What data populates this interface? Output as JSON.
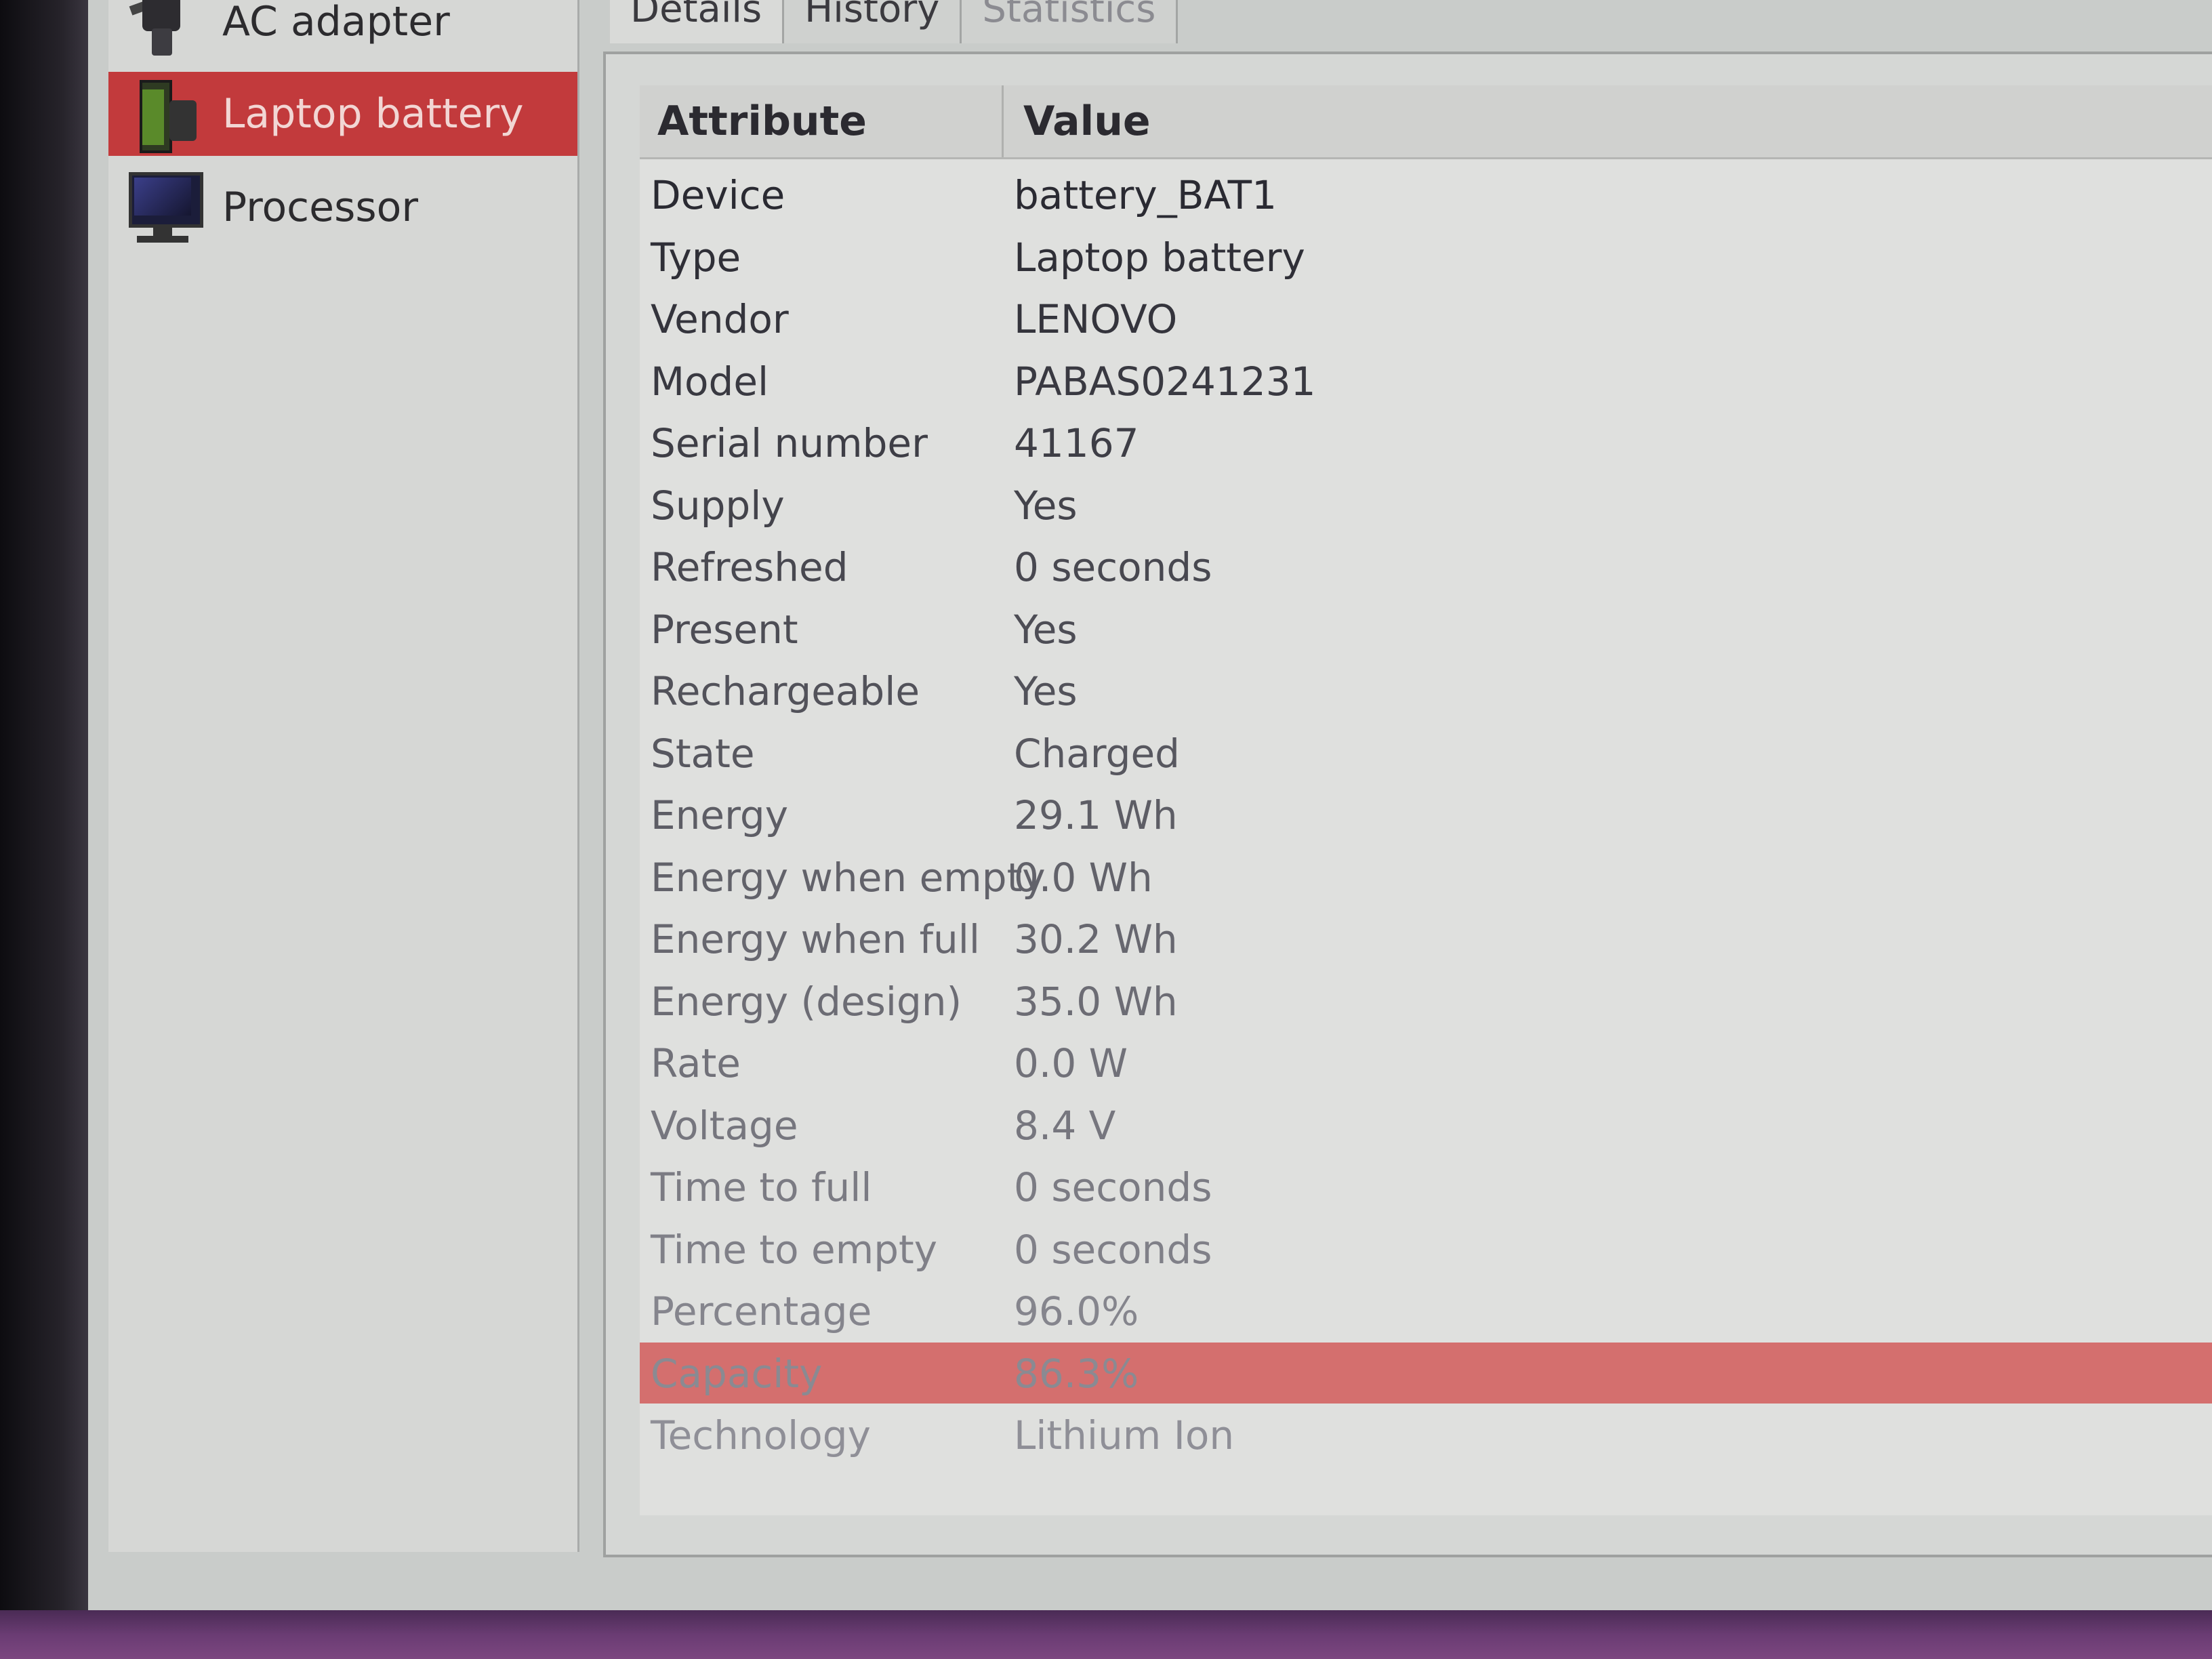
{
  "sidebar": {
    "items": [
      {
        "label": "AC adapter",
        "icon": "ac-adapter-icon"
      },
      {
        "label": "Laptop battery",
        "icon": "battery-icon",
        "selected": true
      },
      {
        "label": "Processor",
        "icon": "processor-icon"
      }
    ]
  },
  "tabs": [
    {
      "label": "Details"
    },
    {
      "label": "History"
    },
    {
      "label": "Statistics"
    }
  ],
  "table": {
    "headers": {
      "attribute": "Attribute",
      "value": "Value"
    },
    "rows": [
      {
        "attribute": "Device",
        "value": "battery_BAT1"
      },
      {
        "attribute": "Type",
        "value": "Laptop battery"
      },
      {
        "attribute": "Vendor",
        "value": "LENOVO"
      },
      {
        "attribute": "Model",
        "value": "PABAS0241231"
      },
      {
        "attribute": "Serial number",
        "value": "41167"
      },
      {
        "attribute": "Supply",
        "value": "Yes"
      },
      {
        "attribute": "Refreshed",
        "value": "0 seconds"
      },
      {
        "attribute": "Present",
        "value": "Yes"
      },
      {
        "attribute": "Rechargeable",
        "value": "Yes"
      },
      {
        "attribute": "State",
        "value": "Charged"
      },
      {
        "attribute": "Energy",
        "value": "29.1 Wh"
      },
      {
        "attribute": "Energy when empty",
        "value": "0.0 Wh"
      },
      {
        "attribute": "Energy when full",
        "value": "30.2 Wh"
      },
      {
        "attribute": "Energy (design)",
        "value": "35.0 Wh"
      },
      {
        "attribute": "Rate",
        "value": "0.0 W"
      },
      {
        "attribute": "Voltage",
        "value": "8.4 V"
      },
      {
        "attribute": "Time to full",
        "value": "0 seconds"
      },
      {
        "attribute": "Time to empty",
        "value": "0 seconds"
      },
      {
        "attribute": "Percentage",
        "value": "96.0%"
      },
      {
        "attribute": "Capacity",
        "value": "86.3%"
      },
      {
        "attribute": "Technology",
        "value": "Lithium Ion"
      }
    ],
    "selected_row": 19
  },
  "colors": {
    "selection": "#c23a3c",
    "row_selection": "#d46f6e"
  }
}
